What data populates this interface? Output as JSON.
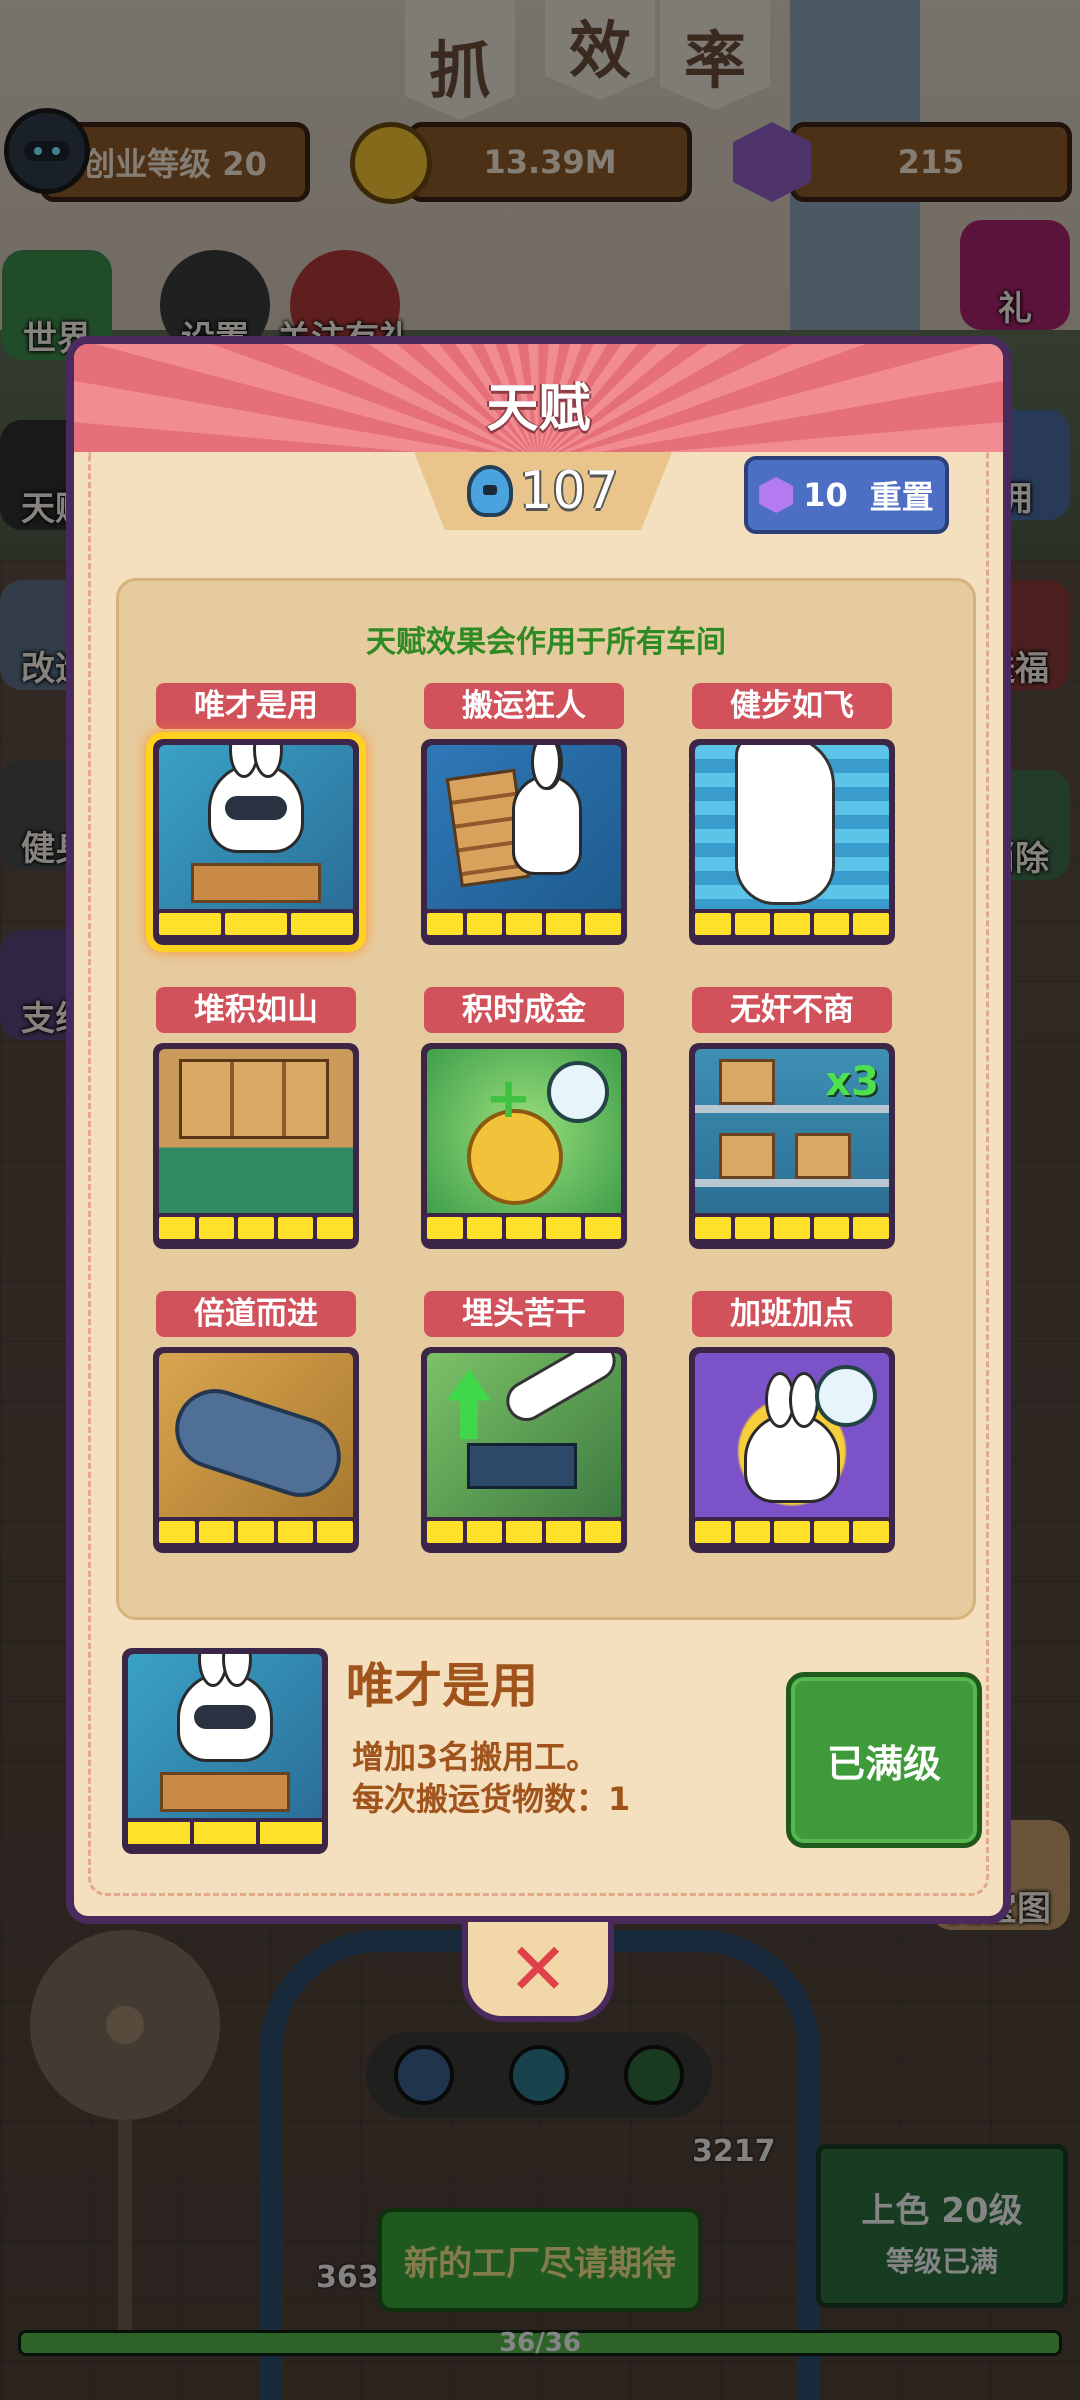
{
  "hud": {
    "level_label": "创业等级 20",
    "coins": "13.39M",
    "gems": "215"
  },
  "banner_flags": [
    "抓",
    "效",
    "率"
  ],
  "side_menu": {
    "left": [
      "世界",
      "天赋",
      "改造",
      "健身",
      "支线"
    ],
    "left_top": [
      "设置",
      "关注有礼"
    ],
    "right": [
      "礼",
      "佣",
      "送福",
      "消除",
      "藏宝图"
    ]
  },
  "modal": {
    "title": "天赋",
    "talent_points": "107",
    "reset_cost": "10",
    "reset_label": "重置",
    "note": "天赋效果会作用于所有车间",
    "talents": [
      {
        "name": "唯才是用",
        "level": 3,
        "max": 3,
        "selected": true,
        "art": "art-blue"
      },
      {
        "name": "搬运狂人",
        "level": 5,
        "max": 5,
        "selected": false,
        "art": "art-teal"
      },
      {
        "name": "健步如飞",
        "level": 5,
        "max": 5,
        "selected": false,
        "art": "art-water"
      },
      {
        "name": "堆积如山",
        "level": 5,
        "max": 5,
        "selected": false,
        "art": "art-box"
      },
      {
        "name": "积时成金",
        "level": 5,
        "max": 5,
        "selected": false,
        "art": "art-green"
      },
      {
        "name": "无奸不商",
        "level": 5,
        "max": 5,
        "selected": false,
        "art": "art-shelf"
      },
      {
        "name": "倍道而进",
        "level": 5,
        "max": 5,
        "selected": false,
        "art": "art-belt"
      },
      {
        "name": "埋头苦干",
        "level": 5,
        "max": 5,
        "selected": false,
        "art": "art-hammer"
      },
      {
        "name": "加班加点",
        "level": 5,
        "max": 5,
        "selected": false,
        "art": "art-purple"
      }
    ],
    "detail": {
      "name": "唯才是用",
      "desc_line1": "增加3名搬用工。",
      "desc_line2": "每次搬运货物数：1",
      "button": "已满级"
    },
    "close_glyph": "✕"
  },
  "bottom": {
    "prod_numbers": [
      "3217",
      "363"
    ],
    "next_factory": "新的工厂尽请期待",
    "level_box_line1": "上色  20级",
    "level_box_line2": "等级已满",
    "progress_text": "36/36",
    "progress_fraction": 1.0
  },
  "colors": {
    "modal_border": "#4a2a5c",
    "label_red": "#d2525c",
    "level_bar_yellow": "#ffe12a",
    "note_green": "#2e8a22",
    "maxed_green": "#3f9a3a"
  }
}
